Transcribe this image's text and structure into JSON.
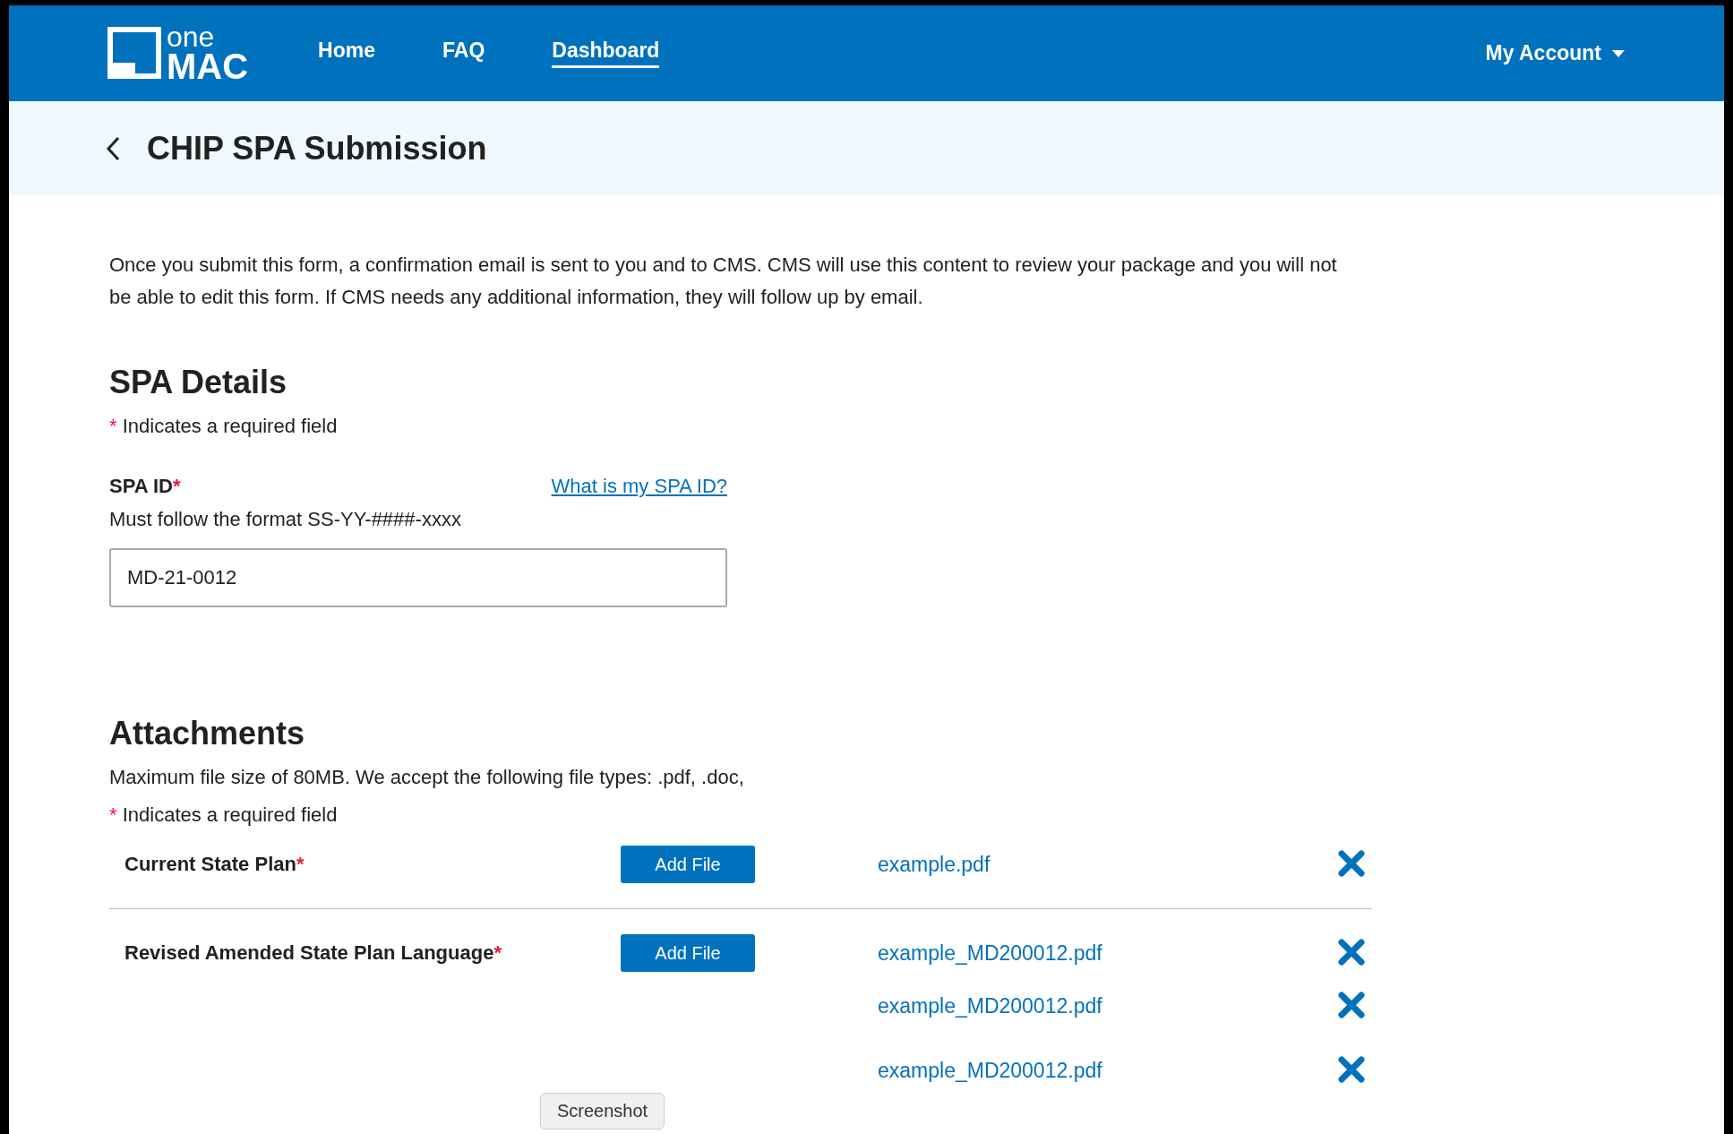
{
  "header": {
    "logo_top": "one",
    "logo_bottom": "MAC",
    "nav": [
      {
        "label": "Home",
        "selected": false
      },
      {
        "label": "FAQ",
        "selected": false
      },
      {
        "label": "Dashboard",
        "selected": true
      }
    ],
    "account": "My Account"
  },
  "page_title": "CHIP SPA Submission",
  "intro": "Once you submit this form, a confirmation email is sent to you and to CMS. CMS will use this content to review your package and you will not be able to edit this form. If CMS needs any additional information, they will follow up by email.",
  "spa_details": {
    "heading": "SPA Details",
    "required_mark": "*",
    "required_note": "Indicates a required field",
    "field": {
      "label": "SPA ID",
      "required_mark": "*",
      "help_link": "What is my SPA ID?",
      "hint": "Must follow the format SS-YY-####-xxxx",
      "value": "MD-21-0012"
    }
  },
  "attachments": {
    "heading": "Attachments",
    "note": "Maximum file size of 80MB. We accept the following file types: .pdf, .doc,",
    "required_mark": "*",
    "required_note": "Indicates a required field",
    "groups": [
      {
        "label": "Current State Plan",
        "required_mark": "*",
        "button": "Add File",
        "files": [
          "example.pdf"
        ]
      },
      {
        "label": "Revised Amended State Plan Language",
        "required_mark": "*",
        "button": "Add File",
        "files": [
          "example_MD200012.pdf",
          "example_MD200012.pdf",
          "example_MD200012.pdf"
        ]
      }
    ]
  },
  "tooltip": "Screenshot"
}
